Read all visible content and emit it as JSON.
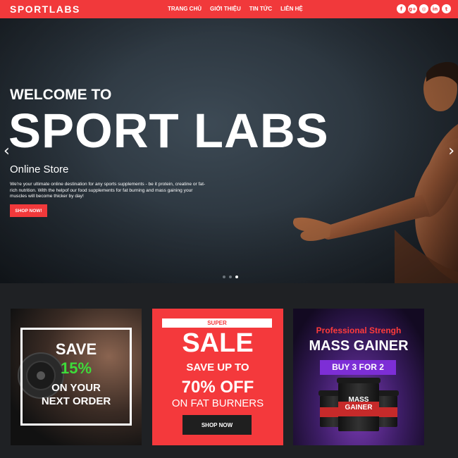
{
  "header": {
    "logo": "SPORTLABS",
    "nav": [
      "TRANG CHỦ",
      "GIỚI THIỆU",
      "TIN TỨC",
      "LIÊN HỆ"
    ],
    "social_icons": [
      "facebook-icon",
      "google-plus-icon",
      "instagram-icon",
      "linkedin-icon",
      "twitter-icon"
    ],
    "social_glyphs": [
      "f",
      "g+",
      "◎",
      "in",
      "t"
    ]
  },
  "hero": {
    "welcome": "WELCOME TO",
    "title": "SPORT LABS",
    "subtitle": "Online Store",
    "description": "We're your ultimate online destination for any sports supplements - be it protein, creatine or fat-rich nutrition. With the helpof our food supplements for fat burning and mass gaining your muscles will become thicker by day!",
    "button": "SHOP NOW!",
    "arrow_left": "‹",
    "arrow_right": "›",
    "slide_count": 3,
    "active_slide": 3
  },
  "banners": {
    "card1": {
      "line1": "SAVE",
      "line2": "15%",
      "line3": "ON YOUR",
      "line4": "NEXT ORDER"
    },
    "card2": {
      "badge": "SUPER",
      "line1": "SALE",
      "line2": "SAVE UP TO",
      "line3": "70% OFF",
      "line4": "ON FAT BURNERS",
      "button": "SHOP NOW"
    },
    "card3": {
      "line1": "Professional Strengh",
      "line2": "MASS GAINER",
      "badge": "BUY 3 FOR 2",
      "product_label": "MASS GAINER"
    }
  },
  "colors": {
    "accent": "#f1393b",
    "green": "#3ddc3a",
    "purple": "#7d2ed6"
  }
}
